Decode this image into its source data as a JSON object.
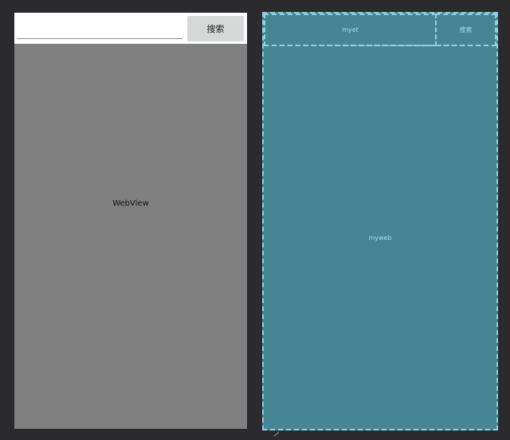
{
  "design_preview": {
    "search_input": {
      "value": "",
      "placeholder": ""
    },
    "search_button_label": "搜索",
    "webview_label": "WebView",
    "colors": {
      "webview_bg": "#808080",
      "toolbar_bg": "#ffffff",
      "button_bg": "#d6d7d7"
    }
  },
  "blueprint_preview": {
    "edittext_id": "myet",
    "button_label": "搜索",
    "webview_id": "myweb",
    "colors": {
      "fill": "#468594",
      "outline": "#8fd0e4",
      "text": "#a3dbe9"
    }
  },
  "canvas": {
    "background": "#2b2b2d"
  }
}
